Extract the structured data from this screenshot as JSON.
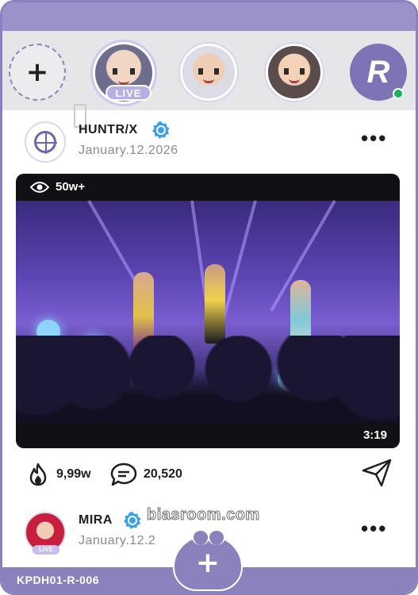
{
  "stories": {
    "add_label": "+",
    "live_badge": "LIVE",
    "items": [
      "story-live",
      "story-2",
      "story-3"
    ]
  },
  "profile": {
    "logo_letter": "R",
    "status": "online"
  },
  "post1": {
    "author": "HUNTR/X",
    "date": "January.12.2026",
    "more": "•••",
    "views": "50w+",
    "duration": "3:19",
    "likes": "9,99w",
    "comments": "20,520"
  },
  "post2": {
    "author": "MIRA",
    "date": "January.12.2",
    "more": "•••",
    "avatar_badge": "LIVE"
  },
  "watermark": "biasroom.com",
  "footer": {
    "code": "KPDH01-R-006",
    "fab_label": "+"
  },
  "colors": {
    "accent": "#8a82bd",
    "verified": "#3aa0e8",
    "online": "#19b45a"
  }
}
